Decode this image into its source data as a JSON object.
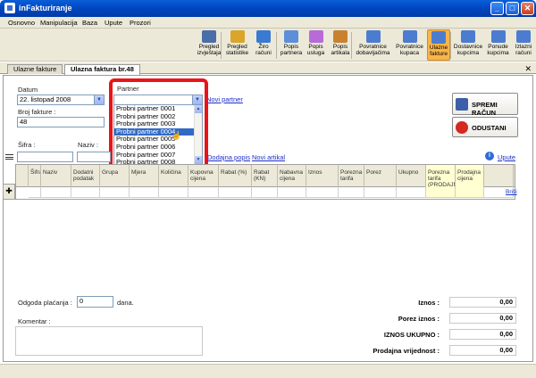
{
  "app": {
    "title": "inFakturiranje"
  },
  "menu": [
    "Osnovno",
    "Manipulacija",
    "Baza",
    "Upute",
    "Prozori"
  ],
  "toolbar": {
    "buttons": [
      {
        "label1": "Pregled",
        "label2": "izvještaja",
        "icon": "report-icon",
        "color": "#4a6ea8"
      },
      {
        "label1": "Pregled",
        "label2": "statistike",
        "icon": "statistics-icon",
        "color": "#d9a62a"
      },
      {
        "label1": "Žiro",
        "label2": "računi",
        "icon": "bank-account-icon",
        "color": "#3a7ad1"
      },
      {
        "label1": "Popis",
        "label2": "partnera",
        "icon": "partners-list-icon",
        "color": "#5d8ed8"
      },
      {
        "label1": "Popis",
        "label2": "usluga",
        "icon": "services-list-icon",
        "color": "#b76ad8"
      },
      {
        "label1": "Popis",
        "label2": "artikala",
        "icon": "items-list-icon",
        "color": "#c8822f"
      },
      {
        "label1": "Povratnice",
        "label2": "dobavljačima",
        "icon": "supplier-returns-icon",
        "color": "#4c7cd0"
      },
      {
        "label1": "Povratnice",
        "label2": "kupaca",
        "icon": "customer-returns-icon",
        "color": "#4c7cd0"
      },
      {
        "label1": "Ulazne",
        "label2": "fakture",
        "icon": "incoming-invoices-icon",
        "color": "#4c7cd0",
        "active": true
      },
      {
        "label1": "Dostavnice",
        "label2": "kupcima",
        "icon": "delivery-notes-icon",
        "color": "#4c7cd0"
      },
      {
        "label1": "Ponude",
        "label2": "kupcima",
        "icon": "offers-icon",
        "color": "#4c7cd0"
      },
      {
        "label1": "Izlazni",
        "label2": "računi",
        "icon": "outgoing-invoices-icon",
        "color": "#4c7cd0"
      }
    ]
  },
  "tabs": [
    {
      "label": "Ulazne fakture",
      "active": false
    },
    {
      "label": "Ulazna faktura br.48",
      "active": true
    }
  ],
  "form": {
    "datum_label": "Datum",
    "datum_value": "22. listopad  2008",
    "broj_label": "Broj fakture :",
    "broj_value": "48",
    "partner_label": "Partner",
    "partner_value": "",
    "novi_partner": "Novi partner",
    "sifra_label": "Šifra :",
    "naziv_label": "Naziv :",
    "dodajna_popis": "Dodajna popis",
    "novi_artikal": "Novi artikal",
    "upute": "Upute"
  },
  "partners": {
    "items": [
      "Probni partner 0001",
      "Probni partner 0002",
      "Probni partner 0003",
      "Probni partner 0004",
      "Probni partner 0005",
      "Probni partner 0006",
      "Probni partner 0007",
      "Probni partner 0008"
    ],
    "selected_index": 3
  },
  "actions": {
    "save": "SPREMI RAČUN",
    "cancel": "ODUSTANI"
  },
  "grid": {
    "columns": [
      "Šifra",
      "Naziv",
      "Dodatni podatak",
      "Grupa",
      "Mjera",
      "Količina",
      "Kupovna cijena",
      "Rabat (%)",
      "Rabat (KN)",
      "Nabavna cijena",
      "Iznos",
      "Porezna tarifa",
      "Porez",
      "Ukupno",
      "Porezna tarifa (PRODAJNA)",
      "Prodajna cijena",
      ""
    ],
    "row_marker": "✚",
    "delete_link": "Briši"
  },
  "footer": {
    "odgoda_label": "Odgoda plaćanja :",
    "odgoda_value": "0",
    "dana": "dana.",
    "komentar_label": "Komentar :",
    "totals": [
      {
        "label": "Iznos :",
        "value": "0,00"
      },
      {
        "label": "Porez iznos :",
        "value": "0,00"
      },
      {
        "label": "IZNOS UKUPNO :",
        "value": "0,00"
      },
      {
        "label": "Prodajna vrijednost :",
        "value": "0,00"
      }
    ]
  },
  "colors": {
    "accent": "#e8141a",
    "selection": "#316ac5",
    "link": "#1b2fc8"
  }
}
